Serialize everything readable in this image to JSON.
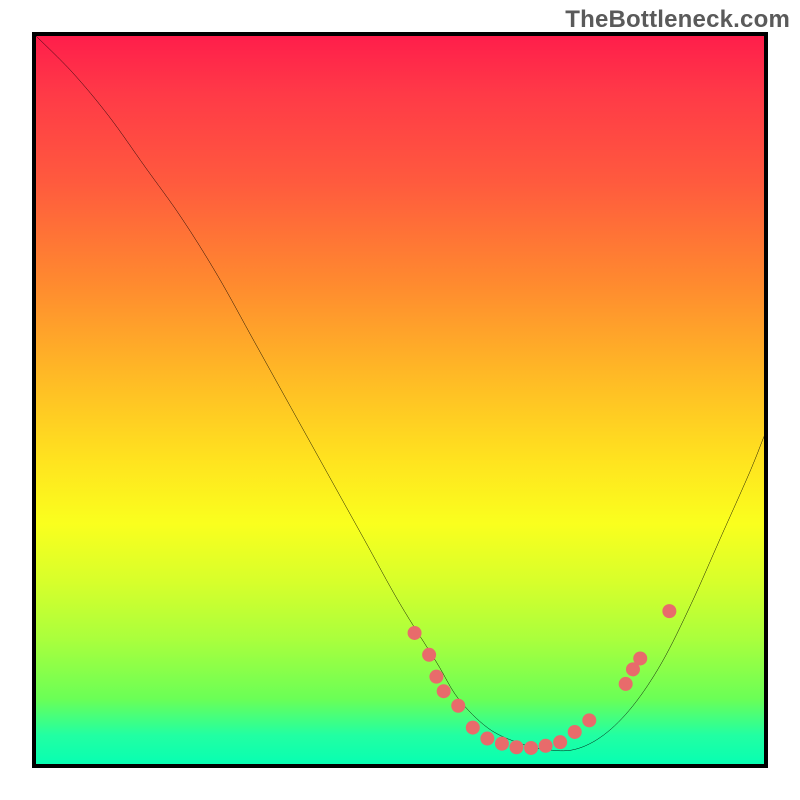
{
  "watermark": "TheBottleneck.com",
  "chart_data": {
    "type": "line",
    "title": "",
    "xlabel": "",
    "ylabel": "",
    "xlim": [
      0,
      100
    ],
    "ylim": [
      0,
      100
    ],
    "grid": false,
    "legend": false,
    "series": [
      {
        "name": "bottleneck-curve",
        "color": "#000000",
        "x": [
          0,
          5,
          10,
          15,
          20,
          25,
          30,
          35,
          40,
          45,
          50,
          55,
          58,
          62,
          66,
          70,
          74,
          78,
          82,
          86,
          90,
          94,
          98,
          100
        ],
        "y": [
          100,
          95,
          89,
          82,
          75,
          67,
          58,
          49,
          40,
          31,
          22,
          14,
          9,
          5,
          3,
          2,
          2,
          4,
          8,
          14,
          22,
          31,
          40,
          45
        ]
      }
    ],
    "markers": [
      {
        "name": "highlight-points",
        "color": "#e86b6b",
        "radius": 7,
        "points": [
          {
            "x": 52,
            "y": 18
          },
          {
            "x": 54,
            "y": 15
          },
          {
            "x": 55,
            "y": 12
          },
          {
            "x": 56,
            "y": 10
          },
          {
            "x": 58,
            "y": 8
          },
          {
            "x": 60,
            "y": 5
          },
          {
            "x": 62,
            "y": 3.5
          },
          {
            "x": 64,
            "y": 2.8
          },
          {
            "x": 66,
            "y": 2.3
          },
          {
            "x": 68,
            "y": 2.2
          },
          {
            "x": 70,
            "y": 2.5
          },
          {
            "x": 72,
            "y": 3.0
          },
          {
            "x": 74,
            "y": 4.4
          },
          {
            "x": 76,
            "y": 6
          },
          {
            "x": 81,
            "y": 11
          },
          {
            "x": 82,
            "y": 13
          },
          {
            "x": 83,
            "y": 14.5
          },
          {
            "x": 87,
            "y": 21
          }
        ]
      }
    ],
    "background_gradient_stops": [
      {
        "pos": 0.0,
        "color": "#ff1e4b"
      },
      {
        "pos": 0.08,
        "color": "#ff3a47"
      },
      {
        "pos": 0.2,
        "color": "#ff5a3e"
      },
      {
        "pos": 0.34,
        "color": "#ff8a2f"
      },
      {
        "pos": 0.46,
        "color": "#ffb726"
      },
      {
        "pos": 0.58,
        "color": "#ffe21f"
      },
      {
        "pos": 0.67,
        "color": "#faff1e"
      },
      {
        "pos": 0.75,
        "color": "#d7ff2b"
      },
      {
        "pos": 0.83,
        "color": "#a9ff3d"
      },
      {
        "pos": 0.91,
        "color": "#6bff56"
      },
      {
        "pos": 0.96,
        "color": "#22ffa2"
      },
      {
        "pos": 1.0,
        "color": "#07ffb2"
      }
    ]
  }
}
